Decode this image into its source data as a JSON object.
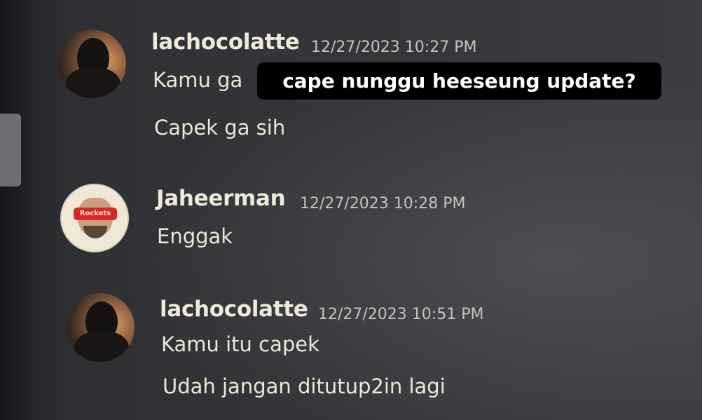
{
  "chat": {
    "messages": [
      {
        "username": "lachocolatte",
        "timestamp": "12/27/2023 10:27 PM",
        "lines": [
          "Kamu ga",
          "Capek ga sih"
        ]
      },
      {
        "username": "Jaheerman",
        "timestamp": "12/27/2023 10:28 PM",
        "lines": [
          "Enggak"
        ]
      },
      {
        "username": "lachocolatte",
        "timestamp": "12/27/2023 10:51 PM",
        "lines": [
          "Kamu itu capek",
          "Udah jangan ditutup2in lagi"
        ]
      }
    ]
  },
  "overlay": {
    "caption": "cape nunggu heeseung update?"
  },
  "avatar_badge": {
    "text": "Rockets"
  }
}
